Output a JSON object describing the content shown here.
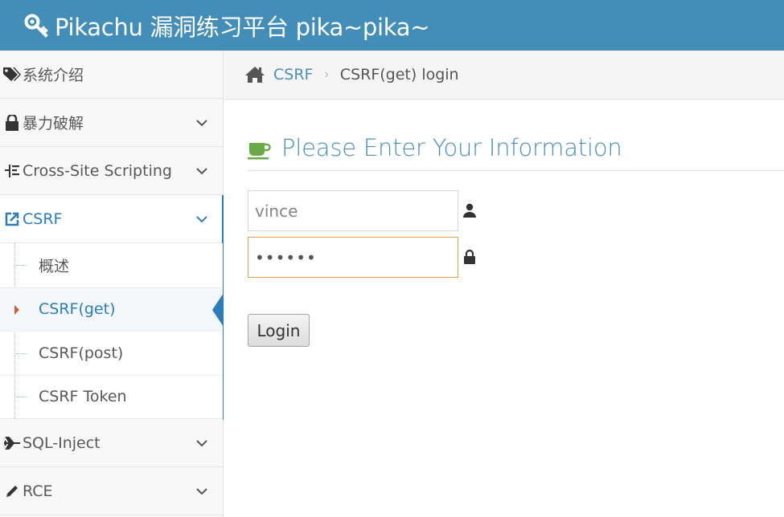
{
  "header": {
    "title": "Pikachu 漏洞练习平台 pika~pika~",
    "icon": "key-icon",
    "bg_color": "#438eb9"
  },
  "sidebar": {
    "items": [
      {
        "label": "系统介绍",
        "icon": "tags-icon",
        "expandable": false
      },
      {
        "label": "暴力破解",
        "icon": "lock-icon",
        "expandable": true
      },
      {
        "label": "Cross-Site Scripting",
        "icon": "tree-icon",
        "expandable": true
      },
      {
        "label": "CSRF",
        "icon": "external-link-icon",
        "expandable": true,
        "active": true,
        "children": [
          {
            "label": "概述"
          },
          {
            "label": "CSRF(get)",
            "current": true
          },
          {
            "label": "CSRF(post)"
          },
          {
            "label": "CSRF Token"
          }
        ]
      },
      {
        "label": "SQL-Inject",
        "icon": "plane-icon",
        "expandable": true
      },
      {
        "label": "RCE",
        "icon": "pencil-icon",
        "expandable": true
      }
    ]
  },
  "breadcrumb": {
    "home_icon": "home-icon",
    "link": "CSRF",
    "current": "CSRF(get) login"
  },
  "main": {
    "title": "Please Enter Your Information",
    "title_icon": "coffee-icon",
    "username_value": "vince",
    "password_mask": "••••••",
    "login_label": "Login"
  },
  "colors": {
    "accent": "#2b7dbc",
    "link": "#4c8fbd",
    "caret": "#c86139",
    "cup": "#69aa46"
  }
}
